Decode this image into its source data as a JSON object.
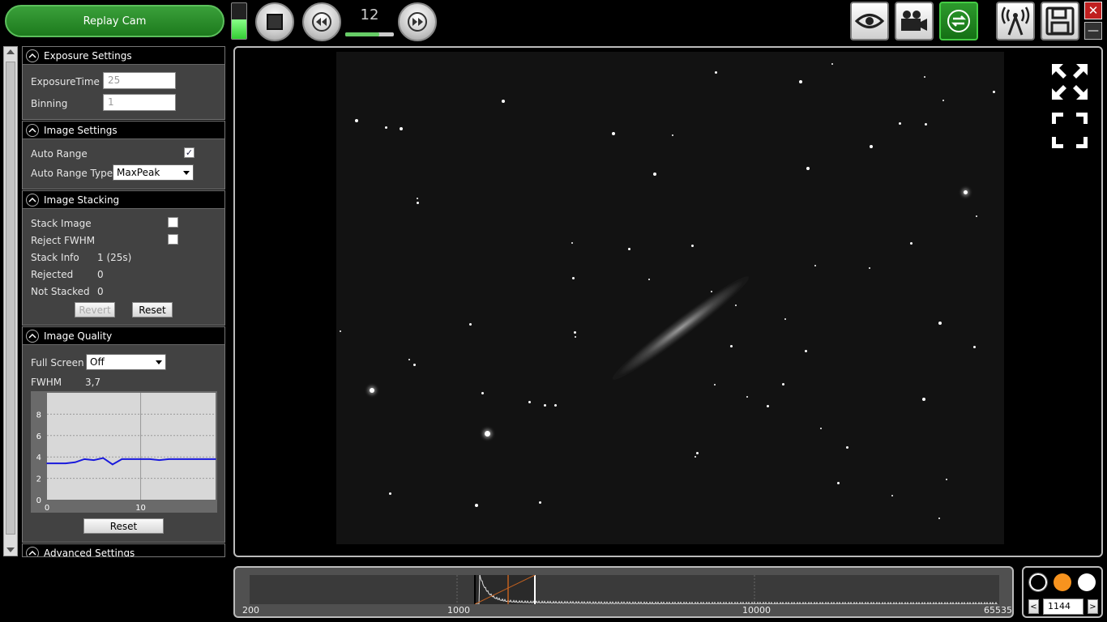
{
  "app": {
    "replay_label": "Replay Cam"
  },
  "toolbar": {
    "frame_counter": "12",
    "level_fraction": 0.55,
    "counter_progress": 0.7
  },
  "exposure": {
    "title": "Exposure Settings",
    "exposure_label": "ExposureTime",
    "exposure_value": "25",
    "binning_label": "Binning",
    "binning_value": "1"
  },
  "image_settings": {
    "title": "Image Settings",
    "auto_range_label": "Auto Range",
    "auto_range_checked": true,
    "auto_range_type_label": "Auto Range Type",
    "auto_range_type_value": "MaxPeak"
  },
  "stacking": {
    "title": "Image Stacking",
    "stack_image_label": "Stack Image",
    "reject_fwhm_label": "Reject FWHM",
    "stack_info_label": "Stack Info",
    "stack_info_value": "1 (25s)",
    "rejected_label": "Rejected",
    "rejected_value": "0",
    "not_stacked_label": "Not Stacked",
    "not_stacked_value": "0",
    "revert_label": "Revert",
    "reset_label": "Reset"
  },
  "quality": {
    "title": "Image Quality",
    "full_screen_label": "Full Screen",
    "full_screen_value": "Off",
    "fwhm_label": "FWHM",
    "fwhm_value": "3,7",
    "reset_label": "Reset"
  },
  "advanced": {
    "title": "Advanced Settings"
  },
  "chart_data": {
    "type": "line",
    "xlabel": "",
    "ylabel": "",
    "xlim": [
      0,
      18
    ],
    "ylim": [
      0,
      10
    ],
    "x_ticks": [
      "0",
      "10"
    ],
    "y_ticks": [
      "0",
      "2",
      "4",
      "6",
      "8"
    ],
    "grid": true,
    "series": [
      {
        "color": "#1a1adc",
        "x": [
          0,
          1,
          2,
          3,
          4,
          5,
          6,
          7,
          8,
          9,
          10,
          11,
          12,
          13,
          14,
          15,
          16,
          17,
          18
        ],
        "values": [
          3.4,
          3.4,
          3.4,
          3.5,
          3.8,
          3.7,
          3.9,
          3.3,
          3.8,
          3.8,
          3.8,
          3.8,
          3.7,
          3.8,
          3.8,
          3.8,
          3.8,
          3.8,
          3.8
        ]
      }
    ]
  },
  "histogram": {
    "labels": [
      "200",
      "1000",
      "10000",
      "65535"
    ]
  },
  "color_picker": {
    "colors": [
      "#000000",
      "#f7931e",
      "#ffffff"
    ],
    "value": "1144",
    "prev": "<",
    "next": ">"
  }
}
